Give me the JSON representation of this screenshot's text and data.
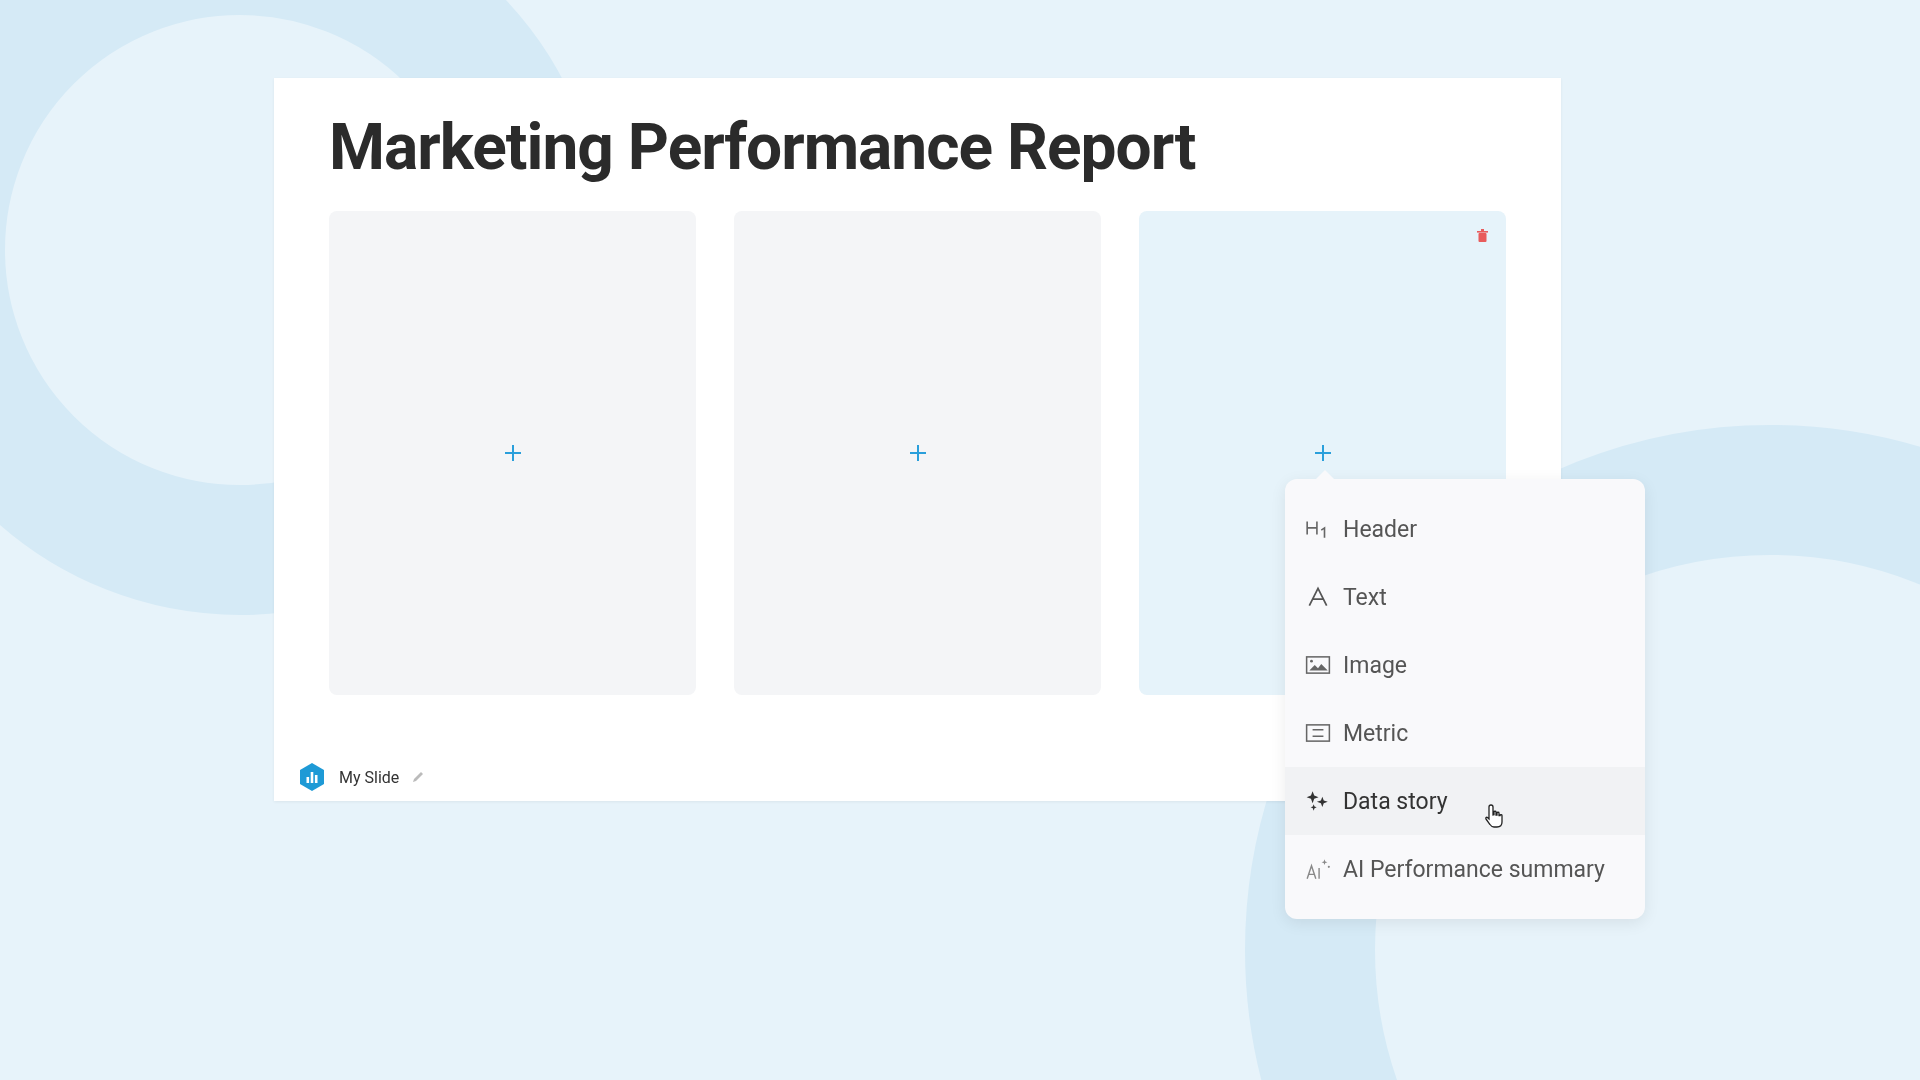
{
  "title": "Marketing Performance Report",
  "panels": [
    {
      "selected": false
    },
    {
      "selected": false
    },
    {
      "selected": true
    }
  ],
  "menu": {
    "items": [
      {
        "kind": "header",
        "label": "Header",
        "hovered": false
      },
      {
        "kind": "text",
        "label": "Text",
        "hovered": false
      },
      {
        "kind": "image",
        "label": "Image",
        "hovered": false
      },
      {
        "kind": "metric",
        "label": "Metric",
        "hovered": false
      },
      {
        "kind": "story",
        "label": "Data story",
        "hovered": true
      },
      {
        "kind": "ai",
        "label": "AI Performance summary",
        "hovered": false
      }
    ]
  },
  "footer": {
    "slide_name": "My Slide"
  }
}
